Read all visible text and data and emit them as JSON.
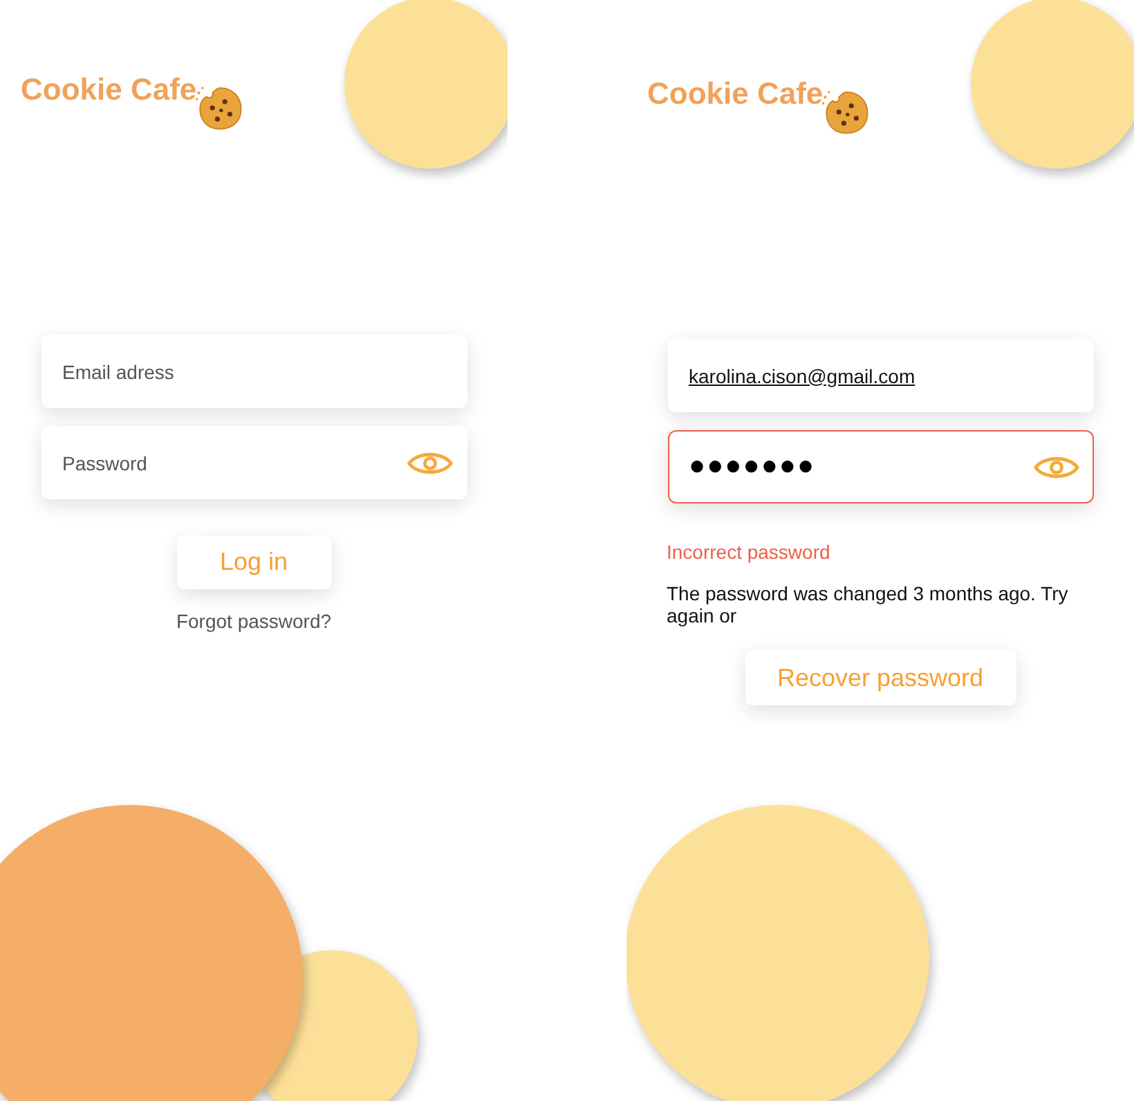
{
  "screens": [
    {
      "kind": "login",
      "logo": "Cookie Cafe",
      "email": {
        "placeholder": "Email adress"
      },
      "password": {
        "placeholder": "Password",
        "error": false
      },
      "primary_button": "Log in",
      "link": "Forgot password?"
    },
    {
      "kind": "error",
      "logo": "Cookie Cafe",
      "email": {
        "value": "karolina.cison@gmail.com"
      },
      "password": {
        "value": "●●●●●●●",
        "error": true
      },
      "error_message": "Incorrect password",
      "message": "The password was changed 3 months ago. Try again or",
      "primary_button": "Recover password"
    }
  ]
}
